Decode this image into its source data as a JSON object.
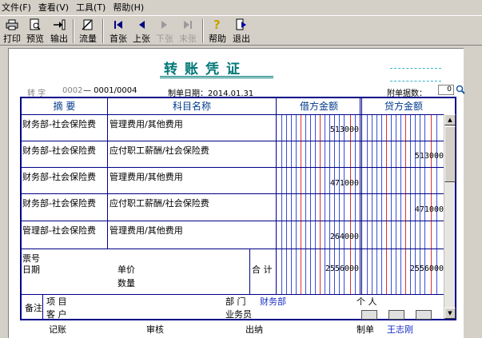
{
  "menu": [
    {
      "label": "文件(F)"
    },
    {
      "label": "查看(V)"
    },
    {
      "label": "工具(T)"
    },
    {
      "label": "帮助(H)"
    }
  ],
  "toolbar": {
    "print": "打印",
    "preview": "预览",
    "export": "输出",
    "flow": "流量",
    "first": "首张",
    "prev": "上张",
    "next": "下张",
    "last": "末张",
    "help": "帮助",
    "exit": "退出"
  },
  "voucher": {
    "title": "转账凭证",
    "type_label": "转 字",
    "type_no": "0002",
    "seq": "— 0001/0004",
    "date_label": "制单日期：2014.01.31",
    "attach_label": "附单据数：",
    "attach_count": "0"
  },
  "table": {
    "headers": {
      "summary": "摘 要",
      "account": "科目名称",
      "debit": "借方金额",
      "credit": "贷方金额"
    },
    "rows": [
      {
        "summary": "财务部-社会保险费",
        "account": "管理费用/其他费用",
        "debit": "513000",
        "credit": ""
      },
      {
        "summary": "财务部-社会保险费",
        "account": "应付职工薪酬/社会保险费",
        "debit": "",
        "credit": "513000"
      },
      {
        "summary": "财务部-社会保险费",
        "account": "管理费用/其他费用",
        "debit": "471000",
        "credit": ""
      },
      {
        "summary": "财务部-社会保险费",
        "account": "应付职工薪酬/社会保险费",
        "debit": "",
        "credit": "471000"
      },
      {
        "summary": "管理部-社会保险费",
        "account": "管理费用/其他费用",
        "debit": "264000",
        "credit": ""
      }
    ],
    "ticket_label": "票号",
    "date_label": "日期",
    "unit_price_label": "单价",
    "quantity_label": "数量",
    "total_label": "合 计",
    "total_debit": "2556000",
    "total_credit": "2556000"
  },
  "notes": {
    "remark_label": "备注",
    "project_label": "项 目",
    "customer_label": "客 户",
    "dept_label": "部 门",
    "dept_value": "财务部",
    "person_label": "个 人",
    "staff_label": "业务员"
  },
  "footer": {
    "bookkeeping": "记账",
    "review": "审核",
    "cashier": "出纳",
    "maker_label": "制单",
    "maker_value": "王志刚"
  },
  "colors": {
    "title": "#007777",
    "grid": "#000088",
    "digit_line": "#3b50d6",
    "unit_line": "#e03030",
    "highlight_text": "#1a2fc8"
  },
  "icons": [
    "print-icon",
    "preview-icon",
    "export-icon",
    "flow-icon",
    "first-icon",
    "prev-icon",
    "next-icon",
    "last-icon",
    "help-icon",
    "exit-icon",
    "search-icon"
  ]
}
